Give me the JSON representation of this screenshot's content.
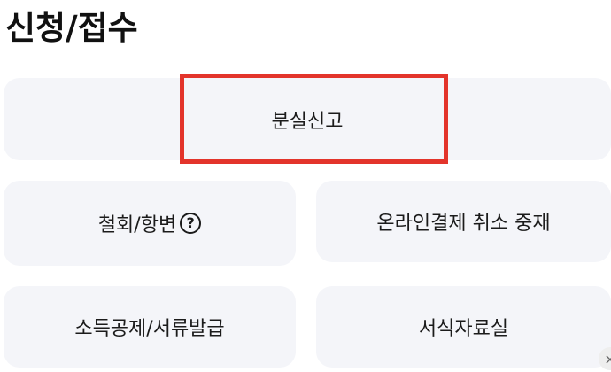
{
  "page": {
    "title": "신청/접수"
  },
  "menu": {
    "lost_report": "분실신고",
    "withdraw_defense": "철회/항변",
    "online_payment_cancel": "온라인결제 취소 중재",
    "tax_deduction_docs": "소득공제/서류발급",
    "forms_library": "서식자료실"
  },
  "icons": {
    "help": "?",
    "close": "×"
  },
  "colors": {
    "card_background": "#f4f5f9",
    "highlight_border": "#e3342b"
  }
}
